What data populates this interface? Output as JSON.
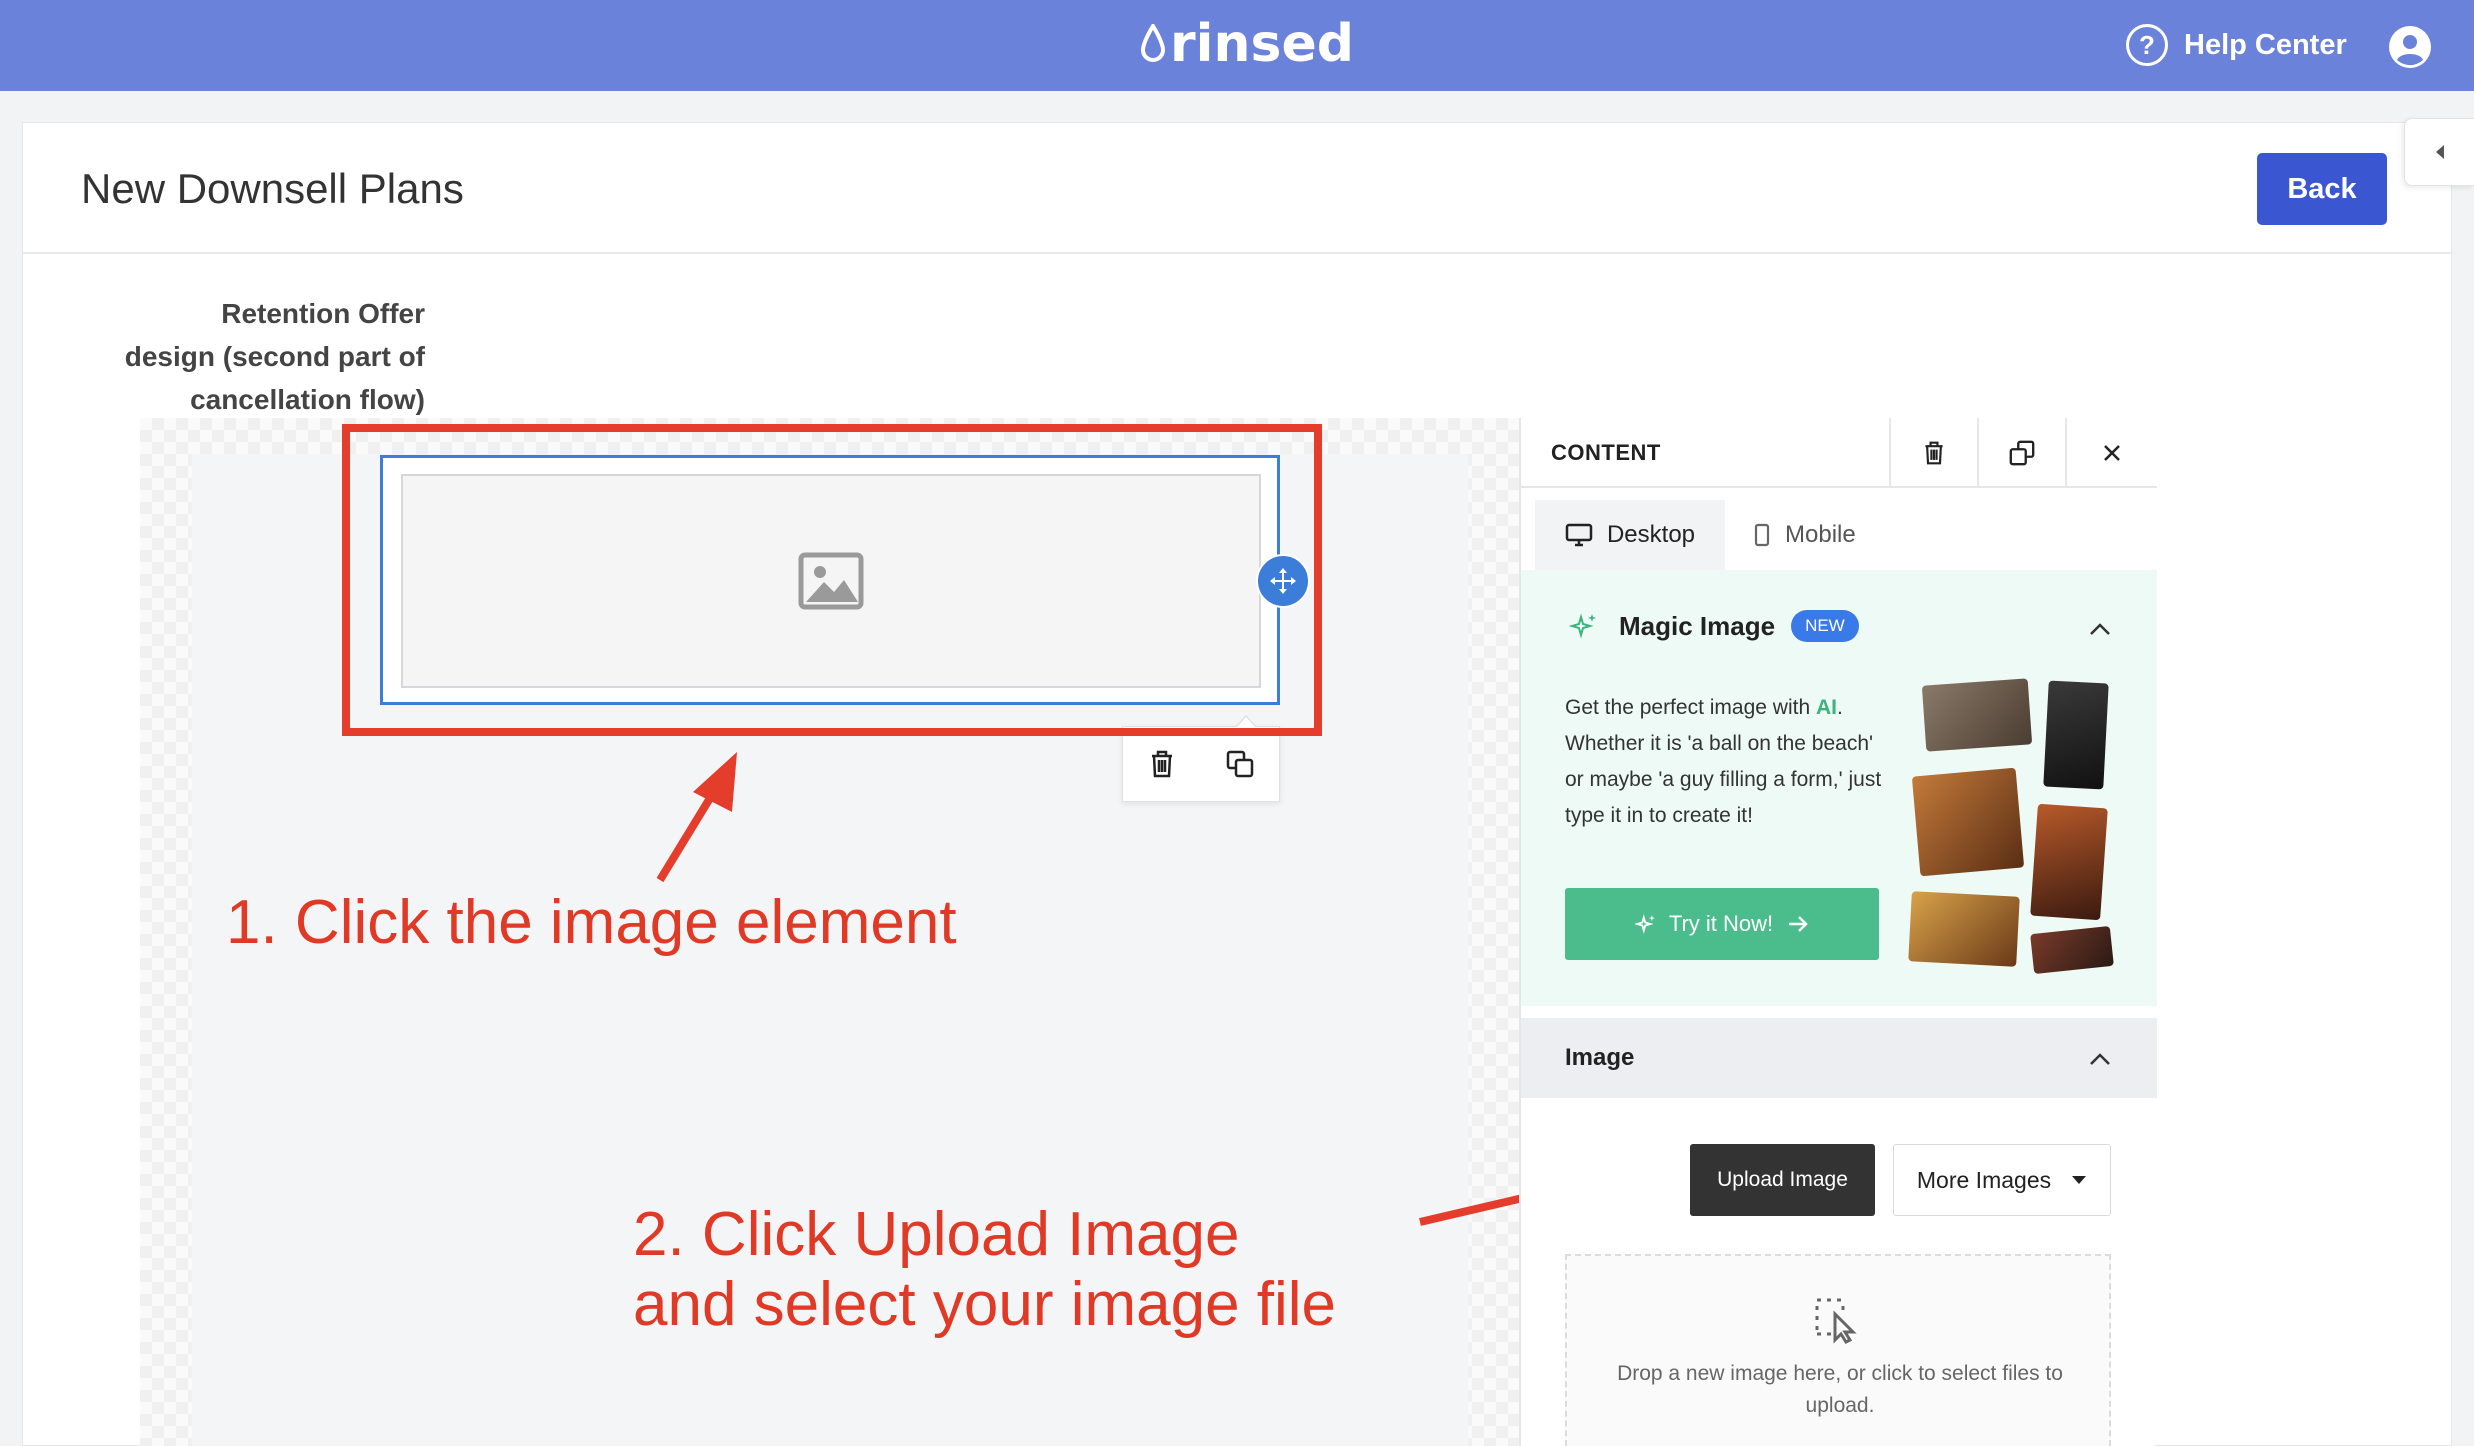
{
  "header": {
    "brand": "rinsed",
    "help_label": "Help Center"
  },
  "page": {
    "title": "New Downsell Plans",
    "back_label": "Back",
    "section_label_line1": "Retention Offer",
    "section_label_line2": "design (second part of",
    "section_label_line3": "cancellation flow)"
  },
  "annotations": {
    "step1": "1. Click the image element",
    "step2_line1": "2. Click Upload Image",
    "step2_line2": "and select your image file"
  },
  "panel": {
    "title": "CONTENT",
    "tabs": [
      {
        "label": "Desktop",
        "icon": "monitor-icon",
        "active": true
      },
      {
        "label": "Mobile",
        "icon": "mobile-icon",
        "active": false
      }
    ],
    "magic": {
      "title": "Magic Image",
      "badge": "NEW",
      "desc_pre": "Get the perfect image with ",
      "desc_ai": "AI",
      "desc_post": ". Whether it is 'a ball on the beach' or maybe 'a guy filling a form,' just type it in to create it!",
      "try_label": "Try it Now!"
    },
    "image_section": {
      "title": "Image",
      "upload_label": "Upload Image",
      "more_label": "More Images",
      "drop_text": "Drop a new image here, or click to select files to upload."
    }
  },
  "colors": {
    "topbar": "#6b82db",
    "primary": "#3a57d1",
    "annotation_red": "#e43d2b",
    "selection_blue": "#3b7dd8",
    "magic_green": "#4bbd8c"
  }
}
